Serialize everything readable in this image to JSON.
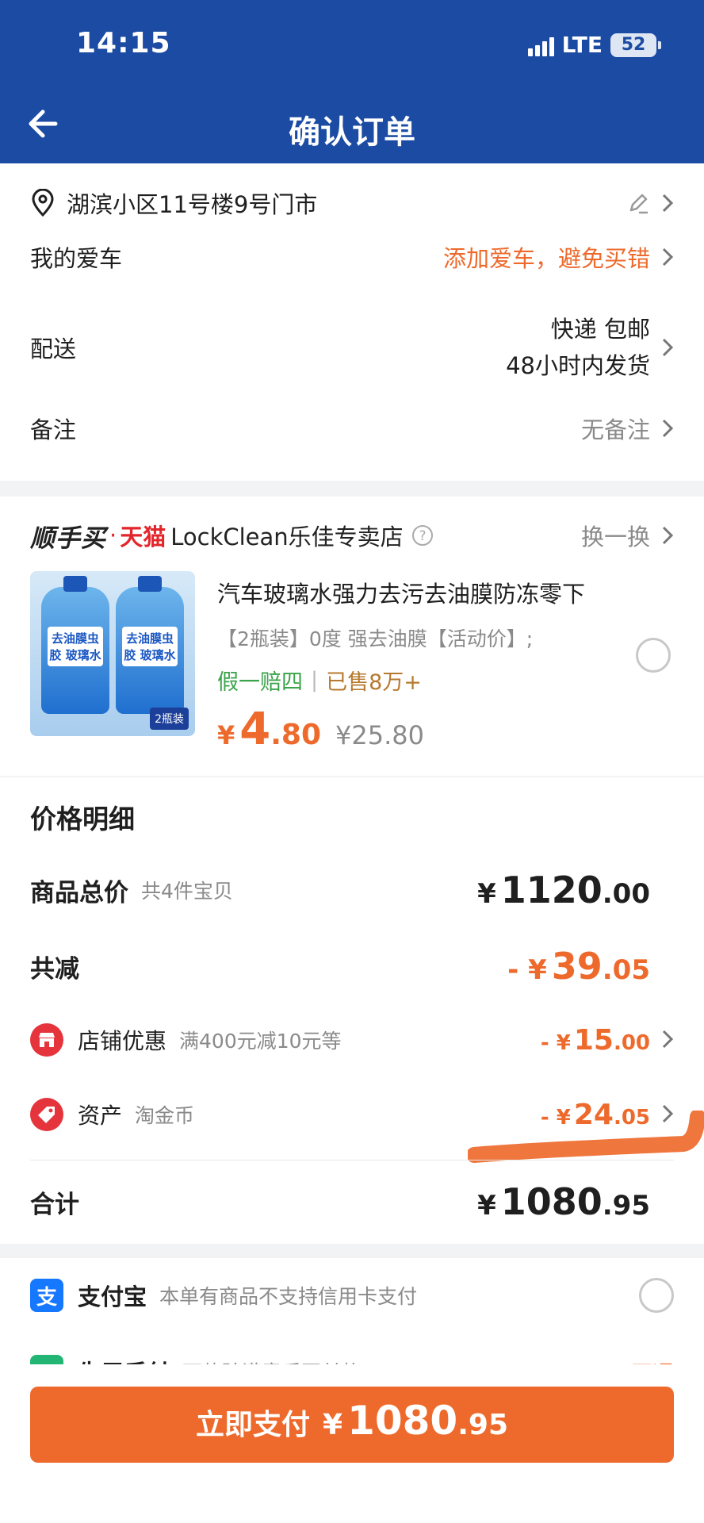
{
  "status_bar": {
    "time": "14:15",
    "network": "LTE",
    "battery": "52"
  },
  "header": {
    "title": "确认订单"
  },
  "address": {
    "text": "湖滨小区11号楼9号门市"
  },
  "car": {
    "label": "我的爱车",
    "action": "添加爱车，避免买错"
  },
  "delivery": {
    "label": "配送",
    "line1": "快递 包邮",
    "line2": "48小时内发货"
  },
  "remark": {
    "label": "备注",
    "value": "无备注"
  },
  "shop": {
    "brand": "顺手买",
    "dot": "·",
    "tmall": "天猫",
    "name": "LockClean乐佳专卖店",
    "switch": "换一换"
  },
  "product": {
    "title": "汽车玻璃水强力去污去油膜防冻零下",
    "spec": "【2瓶装】0度 强去油膜【活动价】;",
    "guarantee": "假一赔四",
    "sold": "已售8万+",
    "price_yen": "¥",
    "price_int": "4",
    "price_dec": ".80",
    "original_price": "¥25.80",
    "image_label": "去油膜虫胶 玻璃水",
    "image_badge": "2瓶装"
  },
  "price_detail": {
    "title": "价格明细",
    "total": {
      "label": "商品总价",
      "sub": "共4件宝贝",
      "yen": "¥",
      "int": "1120",
      "dec": ".00"
    },
    "reduction": {
      "label": "共减",
      "prefix": "- ¥",
      "int": "39",
      "dec": ".05"
    },
    "shop_discount": {
      "label": "店铺优惠",
      "sub": "满400元减10元等",
      "prefix": "- ¥",
      "int": "15",
      "dec": ".00"
    },
    "assets": {
      "label": "资产",
      "sub": "淘金币",
      "prefix": "- ¥",
      "int": "24",
      "dec": ".05"
    },
    "sum": {
      "label": "合计",
      "yen": "¥",
      "int": "1080",
      "dec": ".95"
    }
  },
  "payment": {
    "alipay": {
      "label": "支付宝",
      "sub": "本单有商品不支持信用卡支付"
    },
    "credit": {
      "label": "先用后付",
      "sub": "可体验满意后再付款",
      "action": "开通"
    }
  },
  "pay_button": {
    "label": "立即支付",
    "yen": "¥",
    "int": "1080",
    "dec": ".95"
  },
  "colors": {
    "header": "#1b4ba3",
    "accent": "#ee6a2c",
    "muted": "#8a8a8a"
  }
}
